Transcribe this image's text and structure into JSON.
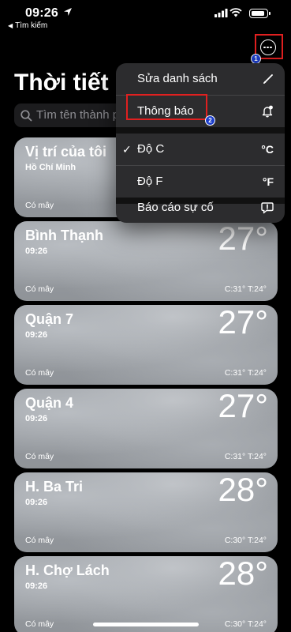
{
  "status_bar": {
    "time": "09:26",
    "back_label": "Tìm kiếm"
  },
  "header": {
    "title": "Thời tiết"
  },
  "search": {
    "placeholder": "Tìm tên thành phố"
  },
  "annotations": {
    "badge1": "1",
    "badge2": "2"
  },
  "menu": {
    "edit_list": "Sửa danh sách",
    "notifications": "Thông báo",
    "celsius": "Độ C",
    "celsius_symbol": "°C",
    "celsius_check": "✓",
    "fahrenheit": "Độ F",
    "fahrenheit_symbol": "°F",
    "report_issue": "Báo cáo sự cố"
  },
  "cards": [
    {
      "city": "Vị trí của tôi",
      "sub": "Hồ Chí Minh",
      "condition": "Có mây",
      "temp": "",
      "hilo": ""
    },
    {
      "city": "Bình Thạnh",
      "sub": "09:26",
      "condition": "Có mây",
      "temp": "27°",
      "hilo": "C:31°  T:24°"
    },
    {
      "city": "Quận 7",
      "sub": "09:26",
      "condition": "Có mây",
      "temp": "27°",
      "hilo": "C:31°  T:24°"
    },
    {
      "city": "Quận 4",
      "sub": "09:26",
      "condition": "Có mây",
      "temp": "27°",
      "hilo": "C:31°  T:24°"
    },
    {
      "city": "H. Ba Tri",
      "sub": "09:26",
      "condition": "Có mây",
      "temp": "28°",
      "hilo": "C:30°  T:24°"
    },
    {
      "city": "H. Chợ Lách",
      "sub": "09:26",
      "condition": "Có mây",
      "temp": "28°",
      "hilo": "C:30°  T:24°"
    }
  ],
  "colors": {
    "highlight": "#e02020",
    "badge": "#1d3fcc",
    "menu_bg": "#2c2c2e"
  }
}
